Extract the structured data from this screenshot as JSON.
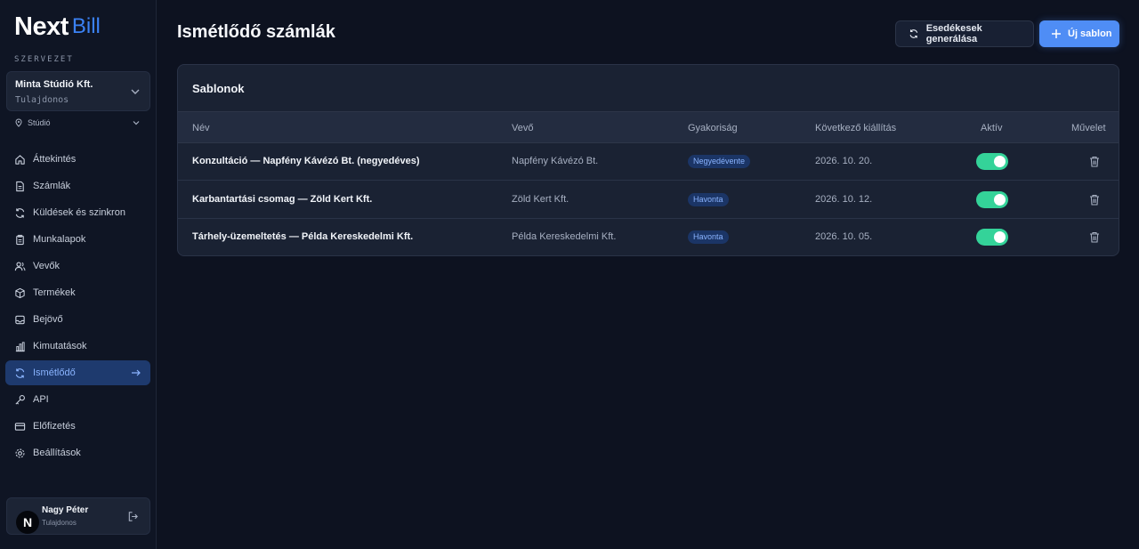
{
  "brand": {
    "logo_main": "Next",
    "logo_sub": "Bill"
  },
  "sidebar": {
    "org_section_label": "SZERVEZET",
    "org": {
      "name": "Minta Stúdió Kft.",
      "role": "Tulajdonos"
    },
    "studio": {
      "label": "Stúdió"
    },
    "items": [
      {
        "label": "Áttekintés",
        "icon": "home-icon"
      },
      {
        "label": "Számlák",
        "icon": "file-icon"
      },
      {
        "label": "Küldések és szinkron",
        "icon": "sync-icon"
      },
      {
        "label": "Munkalapok",
        "icon": "clipboard-icon"
      },
      {
        "label": "Vevők",
        "icon": "users-icon"
      },
      {
        "label": "Termékek",
        "icon": "box-icon"
      },
      {
        "label": "Bejövő",
        "icon": "inbox-icon"
      },
      {
        "label": "Kimutatások",
        "icon": "chart-icon"
      },
      {
        "label": "Ismétlődő",
        "icon": "repeat-icon",
        "active": true
      },
      {
        "label": "API",
        "icon": "key-icon"
      },
      {
        "label": "Előfizetés",
        "icon": "card-icon"
      },
      {
        "label": "Beállítások",
        "icon": "gear-icon"
      }
    ],
    "user": {
      "initial": "N",
      "name": "Nagy Péter",
      "role": "Tulajdonos"
    }
  },
  "header": {
    "title": "Ismétlődő számlák",
    "generate_label": "Esedékesek generálása",
    "new_label": "Új sablon"
  },
  "panel": {
    "title": "Sablonok",
    "columns": [
      "Név",
      "Vevő",
      "Gyakoriság",
      "Következő kiállítás",
      "Aktív",
      "Művelet"
    ],
    "rows": [
      {
        "name": "Konzultáció — Napfény Kávézó Bt. (negyedéves)",
        "customer": "Napfény Kávézó Bt.",
        "frequency": "Negyedévente",
        "next": "2026. 10. 20.",
        "active": true
      },
      {
        "name": "Karbantartási csomag — Zöld Kert Kft.",
        "customer": "Zöld Kert Kft.",
        "frequency": "Havonta",
        "next": "2026. 10. 12.",
        "active": true
      },
      {
        "name": "Tárhely-üzemeltetés — Példa Kereskedelmi Kft.",
        "customer": "Példa Kereskedelmi Kft.",
        "frequency": "Havonta",
        "next": "2026. 10. 05.",
        "active": true
      }
    ]
  },
  "colors": {
    "accent": "#4f8df5",
    "toggle_on": "#34d399",
    "active_nav_bg": "#1e3a6e",
    "badge_bg": "#1b3566"
  }
}
